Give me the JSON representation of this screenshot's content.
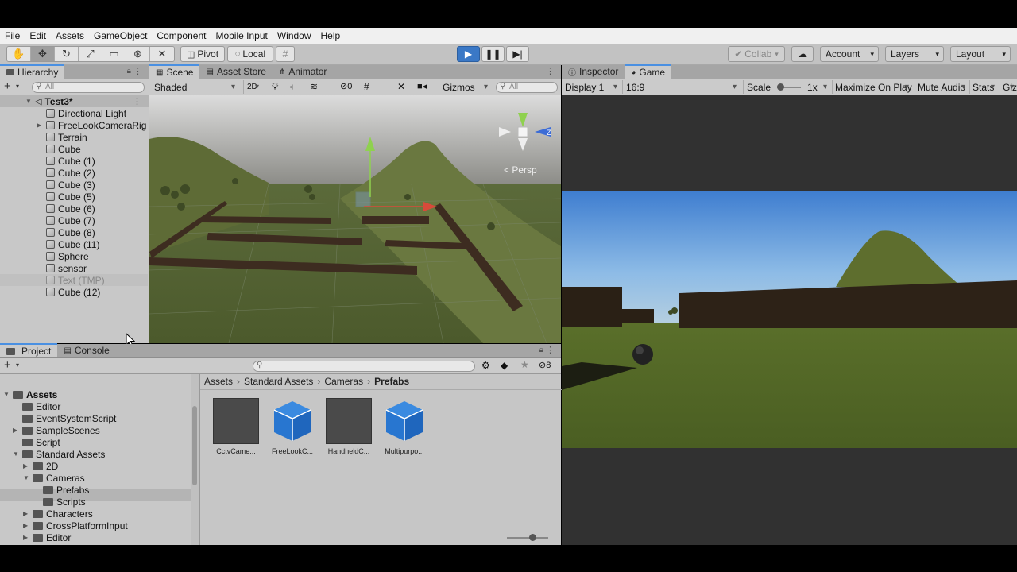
{
  "menu": [
    "File",
    "Edit",
    "Assets",
    "GameObject",
    "Component",
    "Mobile Input",
    "Window",
    "Help"
  ],
  "toolbar": {
    "pivot_label": "Pivot",
    "local_label": "Local",
    "collab_label": "Collab",
    "account_label": "Account",
    "layers_label": "Layers",
    "layout_label": "Layout"
  },
  "hierarchy": {
    "tab_label": "Hierarchy",
    "search_placeholder": "All",
    "scene_name": "Test3*",
    "items": [
      {
        "label": "Directional Light"
      },
      {
        "label": "FreeLookCameraRig"
      },
      {
        "label": "Terrain"
      },
      {
        "label": "Cube"
      },
      {
        "label": "Cube (1)"
      },
      {
        "label": "Cube (2)"
      },
      {
        "label": "Cube (3)"
      },
      {
        "label": "Cube (5)"
      },
      {
        "label": "Cube (6)"
      },
      {
        "label": "Cube (7)"
      },
      {
        "label": "Cube (8)"
      },
      {
        "label": "Cube (11)"
      },
      {
        "label": "Sphere"
      },
      {
        "label": "sensor"
      },
      {
        "label": "Text (TMP)"
      },
      {
        "label": "Cube (12)"
      }
    ]
  },
  "scene": {
    "tabs": [
      "Scene",
      "Asset Store",
      "Animator"
    ],
    "shading": "Shaded",
    "mode_2d": "2D",
    "fx_count": "0",
    "gizmos_label": "Gizmos",
    "search_placeholder": "All",
    "persp_label": "< Persp",
    "axis_z": "Z"
  },
  "game": {
    "tabs": [
      "Inspector",
      "Game"
    ],
    "display": "Display 1",
    "aspect": "16:9",
    "scale_label": "Scale",
    "scale_value": "1x",
    "maximize_label": "Maximize On Play",
    "mute_label": "Mute Audio",
    "stats_label": "Stats",
    "gizmos_label": "Gizm"
  },
  "project": {
    "tabs": [
      "Project",
      "Console"
    ],
    "count": "8",
    "breadcrumb": [
      "Assets",
      "Standard Assets",
      "Cameras",
      "Prefabs"
    ],
    "tree": [
      {
        "label": "Assets"
      },
      {
        "label": "Editor"
      },
      {
        "label": "EventSystemScript"
      },
      {
        "label": "SampleScenes"
      },
      {
        "label": "Script"
      },
      {
        "label": "Standard Assets"
      },
      {
        "label": "2D"
      },
      {
        "label": "Cameras"
      },
      {
        "label": "Prefabs"
      },
      {
        "label": "Scripts"
      },
      {
        "label": "Characters"
      },
      {
        "label": "CrossPlatformInput"
      },
      {
        "label": "Editor"
      }
    ],
    "assets": [
      {
        "label": "CctvCame..."
      },
      {
        "label": "FreeLookC..."
      },
      {
        "label": "HandheldC..."
      },
      {
        "label": "Multipurpo..."
      }
    ]
  },
  "colors": {
    "accent": "#3a78c6",
    "panel": "#c8c8c8",
    "sky": "#7fb3e0",
    "grass": "#4f6a26"
  }
}
